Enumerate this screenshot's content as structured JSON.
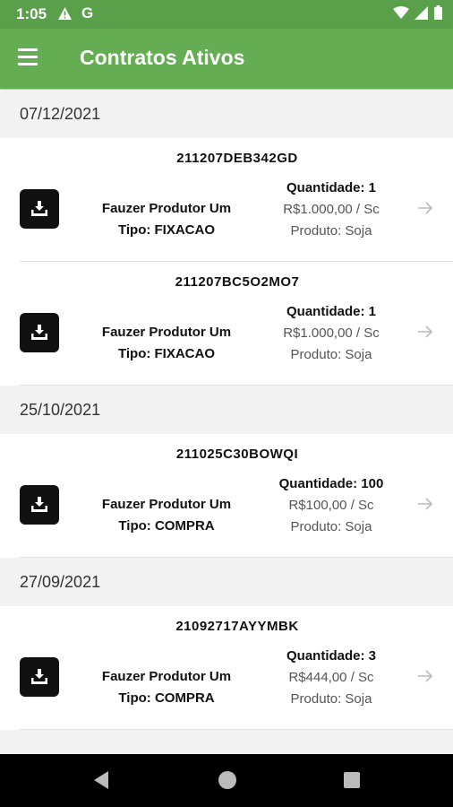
{
  "status_bar": {
    "time": "1:05",
    "left_icons": [
      "warning-icon",
      "google-icon"
    ],
    "right_icons": [
      "wifi-icon",
      "signal-icon",
      "battery-icon"
    ]
  },
  "app_bar": {
    "title": "Contratos Ativos",
    "menu_icon": "hamburger-menu-icon"
  },
  "colors": {
    "status_bar": "#5aa04b",
    "app_bar": "#64ad53",
    "card_bg": "#ffffff",
    "section_bg": "#f2f2f2"
  },
  "sections": [
    {
      "date": "07/12/2021",
      "contracts": [
        {
          "code": "211207DEB342GD",
          "producer": "Fauzer Produtor Um",
          "type": "Tipo: FIXACAO",
          "quantity": "Quantidade: 1",
          "price": "R$1.000,00 / Sc",
          "product": "Produto: Soja"
        },
        {
          "code": "211207BC5O2MO7",
          "producer": "Fauzer Produtor Um",
          "type": "Tipo: FIXACAO",
          "quantity": "Quantidade: 1",
          "price": "R$1.000,00 / Sc",
          "product": "Produto: Soja"
        }
      ]
    },
    {
      "date": "25/10/2021",
      "contracts": [
        {
          "code": "211025C30BOWQI",
          "producer": "Fauzer Produtor Um",
          "type": "Tipo: COMPRA",
          "quantity": "Quantidade: 100",
          "price": "R$100,00 / Sc",
          "product": "Produto: Soja"
        }
      ]
    },
    {
      "date": "27/09/2021",
      "contracts": [
        {
          "code": "21092717AYYMBK",
          "producer": "Fauzer Produtor Um",
          "type": "Tipo: COMPRA",
          "quantity": "Quantidade: 3",
          "price": "R$444,00 / Sc",
          "product": "Produto: Soja"
        }
      ]
    }
  ],
  "nav_bar": {
    "buttons": [
      "back-icon",
      "home-icon",
      "recents-icon"
    ]
  }
}
